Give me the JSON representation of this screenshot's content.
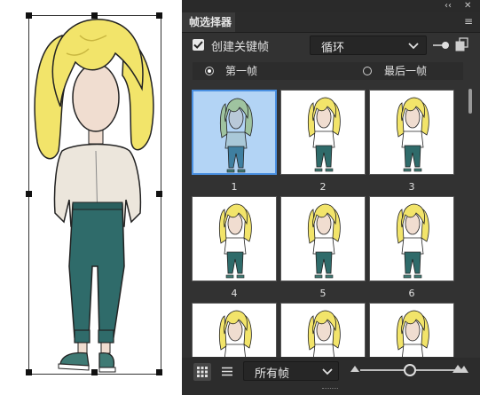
{
  "panel": {
    "collapse_glyph": "‹‹",
    "close_glyph": "✕",
    "menu_glyph": "≡",
    "tab_title": "帧选择器"
  },
  "options": {
    "create_keyframe_label": "创建关键帧",
    "create_keyframe_checked": true,
    "playback_mode": "循环",
    "radio_first_label": "第一帧",
    "radio_last_label": "最后一帧",
    "radio_selected": "第一帧"
  },
  "frames": [
    {
      "number": "1",
      "selected": true
    },
    {
      "number": "2",
      "selected": false
    },
    {
      "number": "3",
      "selected": false
    },
    {
      "number": "4",
      "selected": false
    },
    {
      "number": "5",
      "selected": false
    },
    {
      "number": "6",
      "selected": false
    },
    {
      "number": "",
      "selected": false
    },
    {
      "number": "",
      "selected": false
    },
    {
      "number": "",
      "selected": false
    }
  ],
  "bottom_bar": {
    "filter_value": "所有帧"
  },
  "colors": {
    "panel_bg": "#323232",
    "selection": "#4a90e2",
    "hair": "#f2e46a",
    "pants": "#2f6b6a"
  }
}
